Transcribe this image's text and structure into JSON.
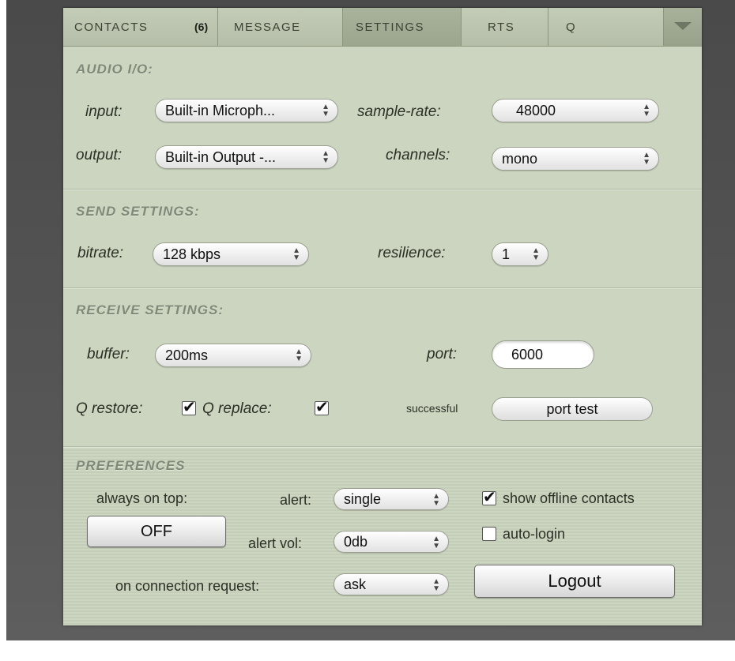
{
  "tabs": [
    {
      "label": "CONTACTS",
      "count": "(6)"
    },
    {
      "label": "MESSAGE"
    },
    {
      "label": "SETTINGS"
    },
    {
      "label": "RTS"
    },
    {
      "label": "Q"
    }
  ],
  "audio_io": {
    "title": "AUDIO I/O:",
    "input_label": "input:",
    "input_value": "Built-in Microph...",
    "output_label": "output:",
    "output_value": "Built-in Output -...",
    "sample_rate_label": "sample-rate:",
    "sample_rate_value": "48000",
    "channels_label": "channels:",
    "channels_value": "mono"
  },
  "send_settings": {
    "title": "SEND SETTINGS:",
    "bitrate_label": "bitrate:",
    "bitrate_value": "128 kbps",
    "resilience_label": "resilience:",
    "resilience_value": "1"
  },
  "receive_settings": {
    "title": "RECEIVE SETTINGS:",
    "buffer_label": "buffer:",
    "buffer_value": "200ms",
    "port_label": "port:",
    "port_value": "6000",
    "q_restore_label": "Q restore:",
    "q_restore_checked": true,
    "q_replace_label": "Q replace:",
    "q_replace_checked": true,
    "port_status": "successful",
    "port_test_label": "port test"
  },
  "preferences": {
    "title": "PREFERENCES",
    "always_on_top_label": "always on top:",
    "always_on_top_button": "OFF",
    "alert_label": "alert:",
    "alert_value": "single",
    "alert_vol_label": "alert vol:",
    "alert_vol_value": "0db",
    "connection_request_label": "on connection request:",
    "connection_request_value": "ask",
    "show_offline_label": "show offline contacts",
    "show_offline_checked": true,
    "auto_login_label": "auto-login",
    "auto_login_checked": false,
    "logout_label": "Logout"
  },
  "colors": {
    "panel": "#cbd5bf",
    "section_title": "#7f8977",
    "backdrop": "#555555"
  }
}
